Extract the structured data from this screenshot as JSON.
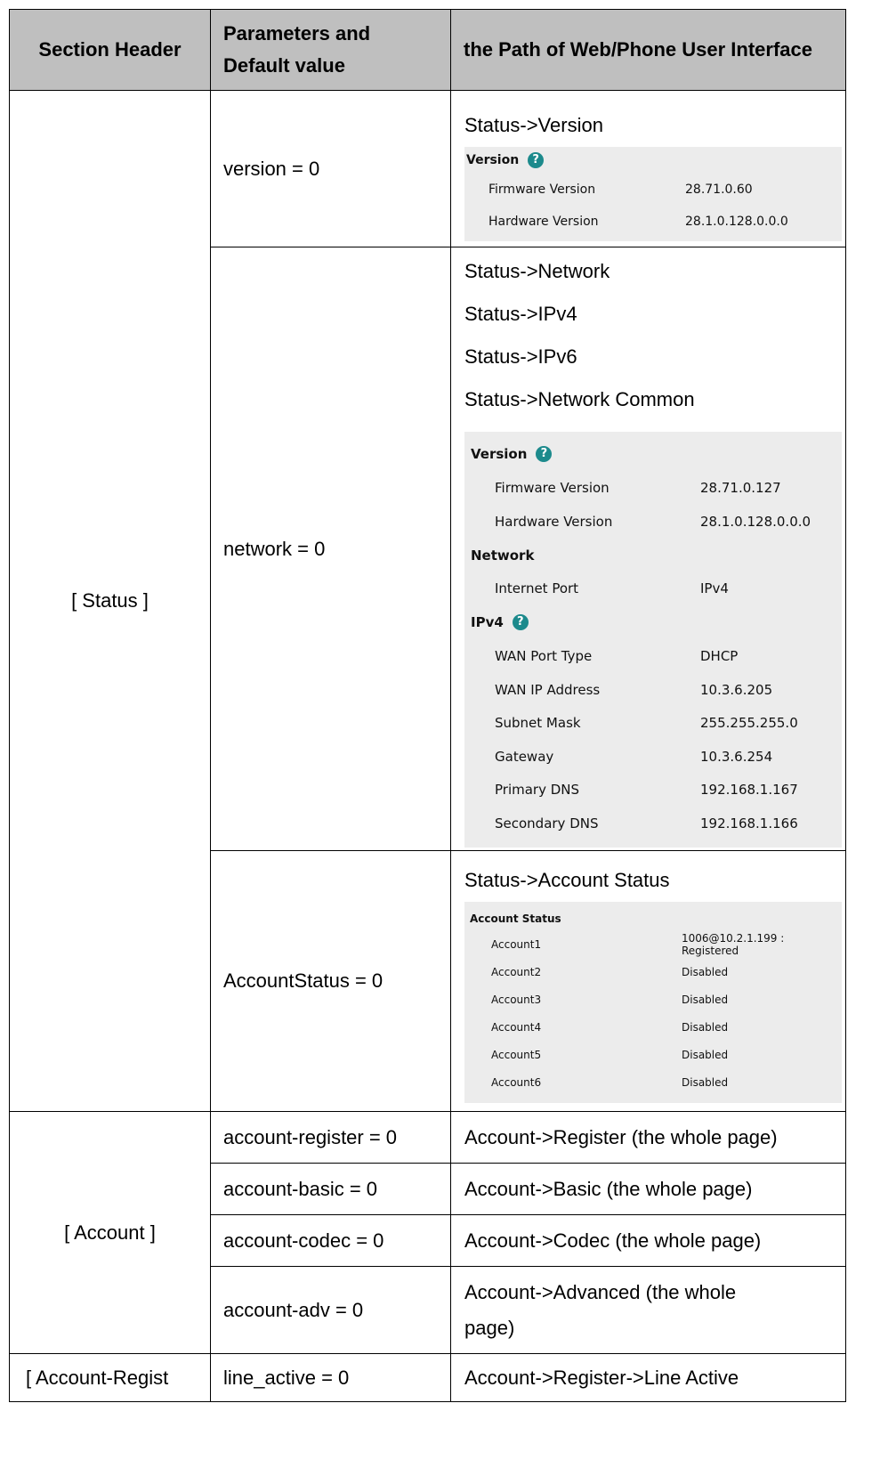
{
  "header": {
    "col1": "Section Header",
    "col2_line1": "Parameters and",
    "col2_line2": "Default value",
    "col3": "the Path of Web/Phone User Interface"
  },
  "status": {
    "section": "[ Status ]",
    "version": {
      "param": "version = 0",
      "path": "Status->Version",
      "panel": {
        "title": "Version",
        "help": "?",
        "rows": [
          {
            "k": "Firmware Version",
            "v": "28.71.0.60"
          },
          {
            "k": "Hardware Version",
            "v": "28.1.0.128.0.0.0"
          }
        ]
      }
    },
    "network": {
      "param": "network = 0",
      "paths": [
        "Status->Network",
        "Status->IPv4",
        "Status->IPv6",
        "Status->Network Common"
      ],
      "panel": {
        "version_title": "Version",
        "help": "?",
        "version_rows": [
          {
            "k": "Firmware Version",
            "v": "28.71.0.127"
          },
          {
            "k": "Hardware Version",
            "v": "28.1.0.128.0.0.0"
          }
        ],
        "network_title": "Network",
        "network_rows": [
          {
            "k": "Internet Port",
            "v": "IPv4"
          }
        ],
        "ipv4_title": "IPv4",
        "ipv4_rows": [
          {
            "k": "WAN Port Type",
            "v": "DHCP"
          },
          {
            "k": "WAN IP Address",
            "v": "10.3.6.205"
          },
          {
            "k": "Subnet Mask",
            "v": "255.255.255.0"
          },
          {
            "k": "Gateway",
            "v": "10.3.6.254"
          },
          {
            "k": "Primary DNS",
            "v": "192.168.1.167"
          },
          {
            "k": "Secondary DNS",
            "v": "192.168.1.166"
          }
        ]
      }
    },
    "account_status": {
      "param": "AccountStatus = 0",
      "path": "Status->Account Status",
      "panel": {
        "title": "Account Status",
        "rows": [
          {
            "k": "Account1",
            "v": "1006@10.2.1.199 : Registered"
          },
          {
            "k": "Account2",
            "v": "Disabled"
          },
          {
            "k": "Account3",
            "v": "Disabled"
          },
          {
            "k": "Account4",
            "v": "Disabled"
          },
          {
            "k": "Account5",
            "v": "Disabled"
          },
          {
            "k": "Account6",
            "v": "Disabled"
          }
        ]
      }
    }
  },
  "account": {
    "section": "[ Account ]",
    "rows": [
      {
        "param": "account-register = 0",
        "path": "Account->Register (the whole page)"
      },
      {
        "param": "account-basic = 0",
        "path": "Account->Basic (the whole page)"
      },
      {
        "param": "account-codec = 0",
        "path": "Account->Codec (the whole page)"
      },
      {
        "param": "account-adv = 0",
        "path_line1": "Account->Advanced (the whole",
        "path_line2": "page)"
      }
    ]
  },
  "account_register": {
    "section": "[ Account-Regist",
    "param": "line_active = 0",
    "path": "Account->Register->Line Active"
  }
}
